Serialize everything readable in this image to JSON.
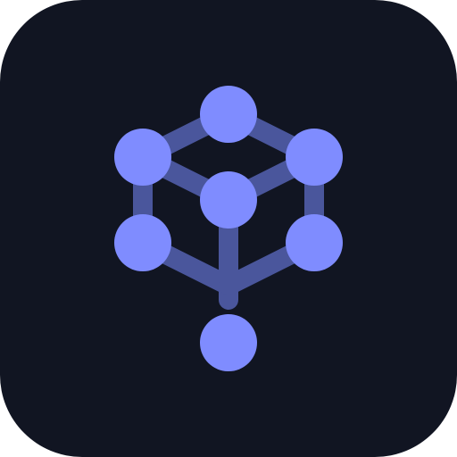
{
  "icon": {
    "name": "network-cube-icon",
    "colors": {
      "background": "#111522",
      "node": "#7F8CFF",
      "edge": "#4A569C"
    }
  }
}
